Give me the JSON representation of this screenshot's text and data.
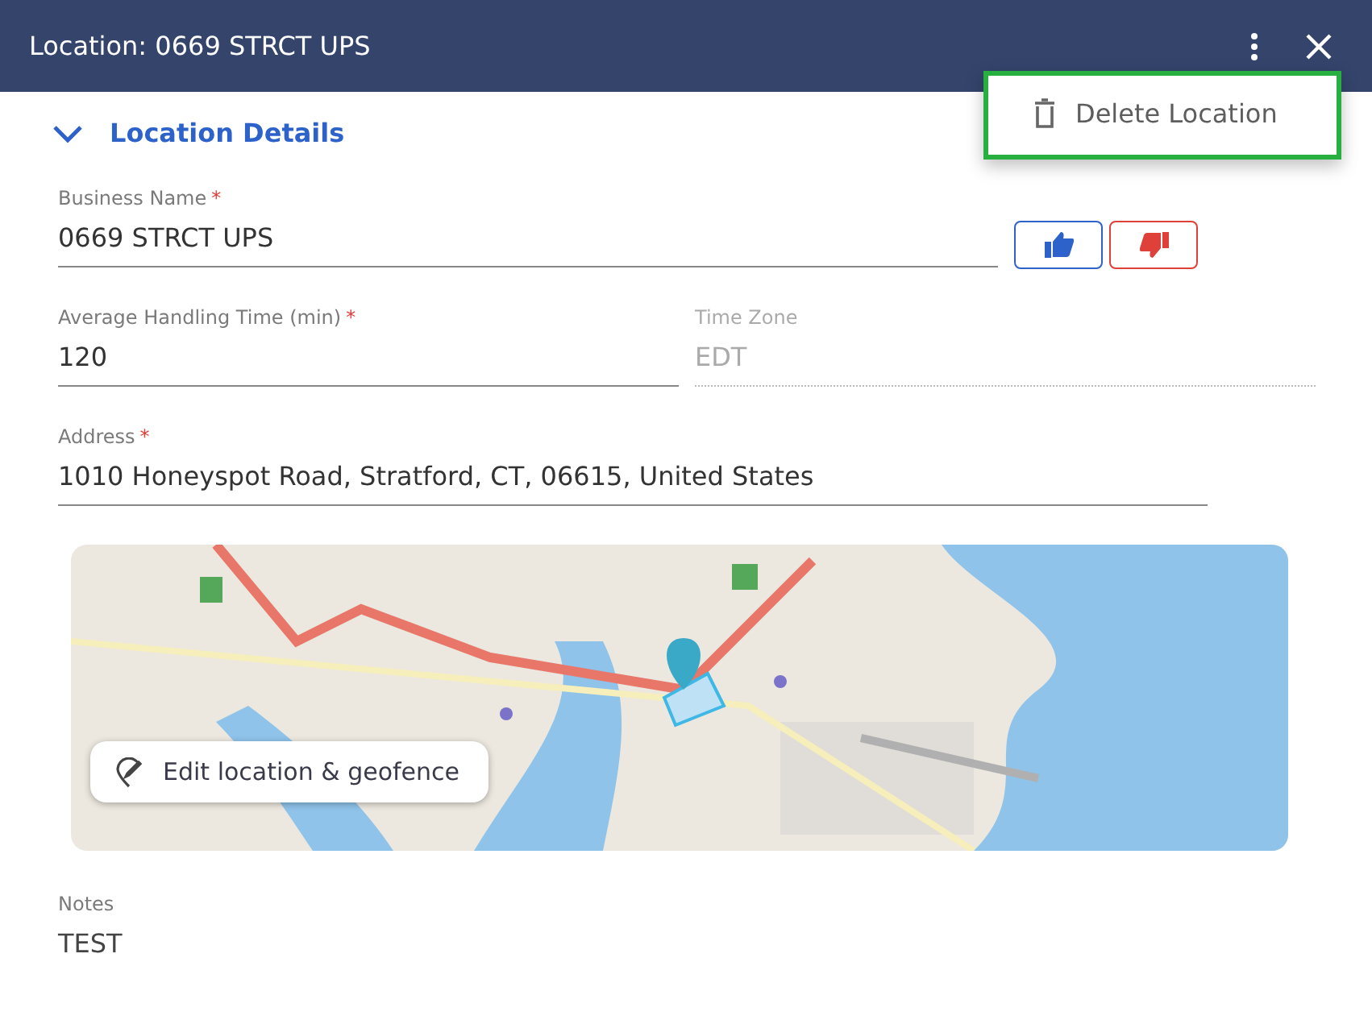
{
  "window": {
    "title": "Location: 0669 STRCT UPS"
  },
  "menu": {
    "open": true,
    "items": [
      {
        "label": "Delete Location",
        "kind": "delete"
      }
    ]
  },
  "required_marker": "*",
  "section": {
    "title": "Location Details",
    "expanded": true
  },
  "fields": [
    {
      "label": "Business Name",
      "required": true,
      "value": "0669 STRCT UPS",
      "disabled": false,
      "kind": "vote"
    },
    {
      "label": "Average Handling Time (min)",
      "required": true,
      "value": "120",
      "disabled": false,
      "kind": "half"
    },
    {
      "label": "Time Zone",
      "required": false,
      "value": "EDT",
      "disabled": true,
      "kind": "half"
    },
    {
      "label": "Address",
      "required": true,
      "value": "1010 Honeyspot Road, Stratford, CT, 06615, United States",
      "disabled": false,
      "kind": "wide"
    }
  ],
  "map": {
    "kind": "picture",
    "button": "Edit location & geofence"
  },
  "notes": {
    "label": "Notes",
    "value": "TEST"
  }
}
